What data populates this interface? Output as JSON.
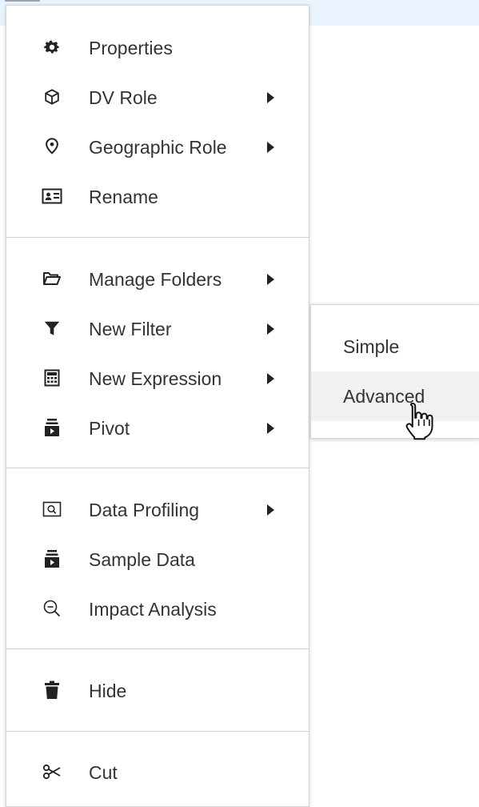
{
  "menu": {
    "items": [
      {
        "label": "Properties",
        "icon": "gear-icon",
        "has_submenu": false
      },
      {
        "label": "DV Role",
        "icon": "cube-icon",
        "has_submenu": true
      },
      {
        "label": "Geographic Role",
        "icon": "map-pin-icon",
        "has_submenu": true
      },
      {
        "label": "Rename",
        "icon": "id-card-icon",
        "has_submenu": false
      },
      {
        "label": "Manage Folders",
        "icon": "folder-open-icon",
        "has_submenu": true
      },
      {
        "label": "New Filter",
        "icon": "filter-icon",
        "has_submenu": true
      },
      {
        "label": "New Expression",
        "icon": "calculator-icon",
        "has_submenu": true
      },
      {
        "label": "Pivot",
        "icon": "pivot-icon",
        "has_submenu": true
      },
      {
        "label": "Data Profiling",
        "icon": "search-window-icon",
        "has_submenu": true
      },
      {
        "label": "Sample Data",
        "icon": "sample-data-icon",
        "has_submenu": false
      },
      {
        "label": "Impact Analysis",
        "icon": "zoom-out-icon",
        "has_submenu": false
      },
      {
        "label": "Hide",
        "icon": "trash-icon",
        "has_submenu": false
      },
      {
        "label": "Cut",
        "icon": "scissors-icon",
        "has_submenu": false
      }
    ]
  },
  "submenu": {
    "parent": "New Filter",
    "items": [
      {
        "label": "Simple"
      },
      {
        "label": "Advanced"
      }
    ],
    "hovered": "Advanced"
  },
  "colors": {
    "highlight_strip": "#e8f3fd",
    "hover_background": "#f1f1f1",
    "text": "#333333",
    "icon": "#222222"
  }
}
